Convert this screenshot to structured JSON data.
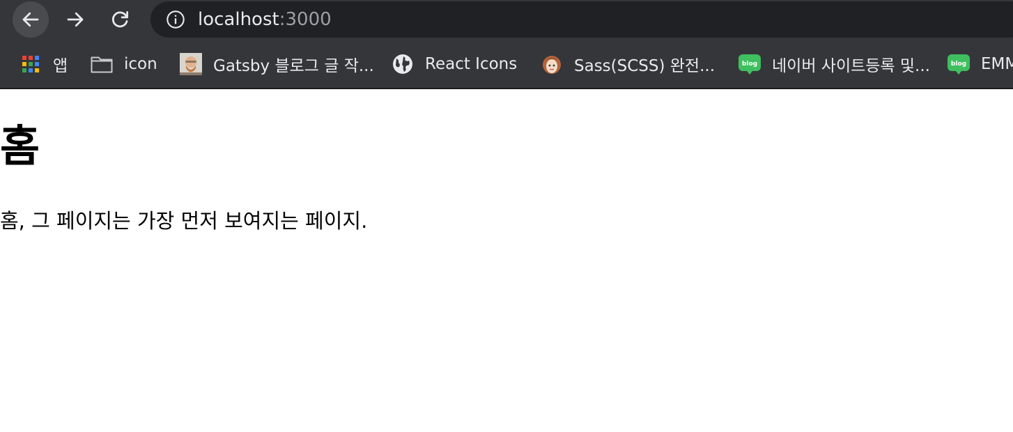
{
  "browser": {
    "url_host": "localhost",
    "url_port": ":3000",
    "icons": {
      "back": "arrow-left-icon",
      "forward": "arrow-right-icon",
      "reload": "reload-icon",
      "site_info": "info-icon"
    }
  },
  "bookmarks": [
    {
      "label": "앱",
      "icon": "apps-grid-icon"
    },
    {
      "label": "icon",
      "icon": "folder-icon"
    },
    {
      "label": "Gatsby 블로그 글 작...",
      "icon": "avatar-favicon"
    },
    {
      "label": "React Icons",
      "icon": "globe-icon"
    },
    {
      "label": "Sass(SCSS) 완전...",
      "icon": "cartoon-avatar-favicon"
    },
    {
      "label": "네이버 사이트등록 및...",
      "icon": "blog-favicon",
      "badge": "blog"
    },
    {
      "label": "EMM",
      "icon": "blog-favicon",
      "badge": "blog"
    }
  ],
  "page": {
    "title": "홈",
    "text": "홈, 그 페이지는 가장 먼저 보여지는 페이지."
  },
  "colors": {
    "toolbar": "#35363a",
    "omnibox": "#202124",
    "text_light": "#e8eaed",
    "port_gray": "#9aa0a6",
    "blog_green": "#3fbf5f"
  }
}
